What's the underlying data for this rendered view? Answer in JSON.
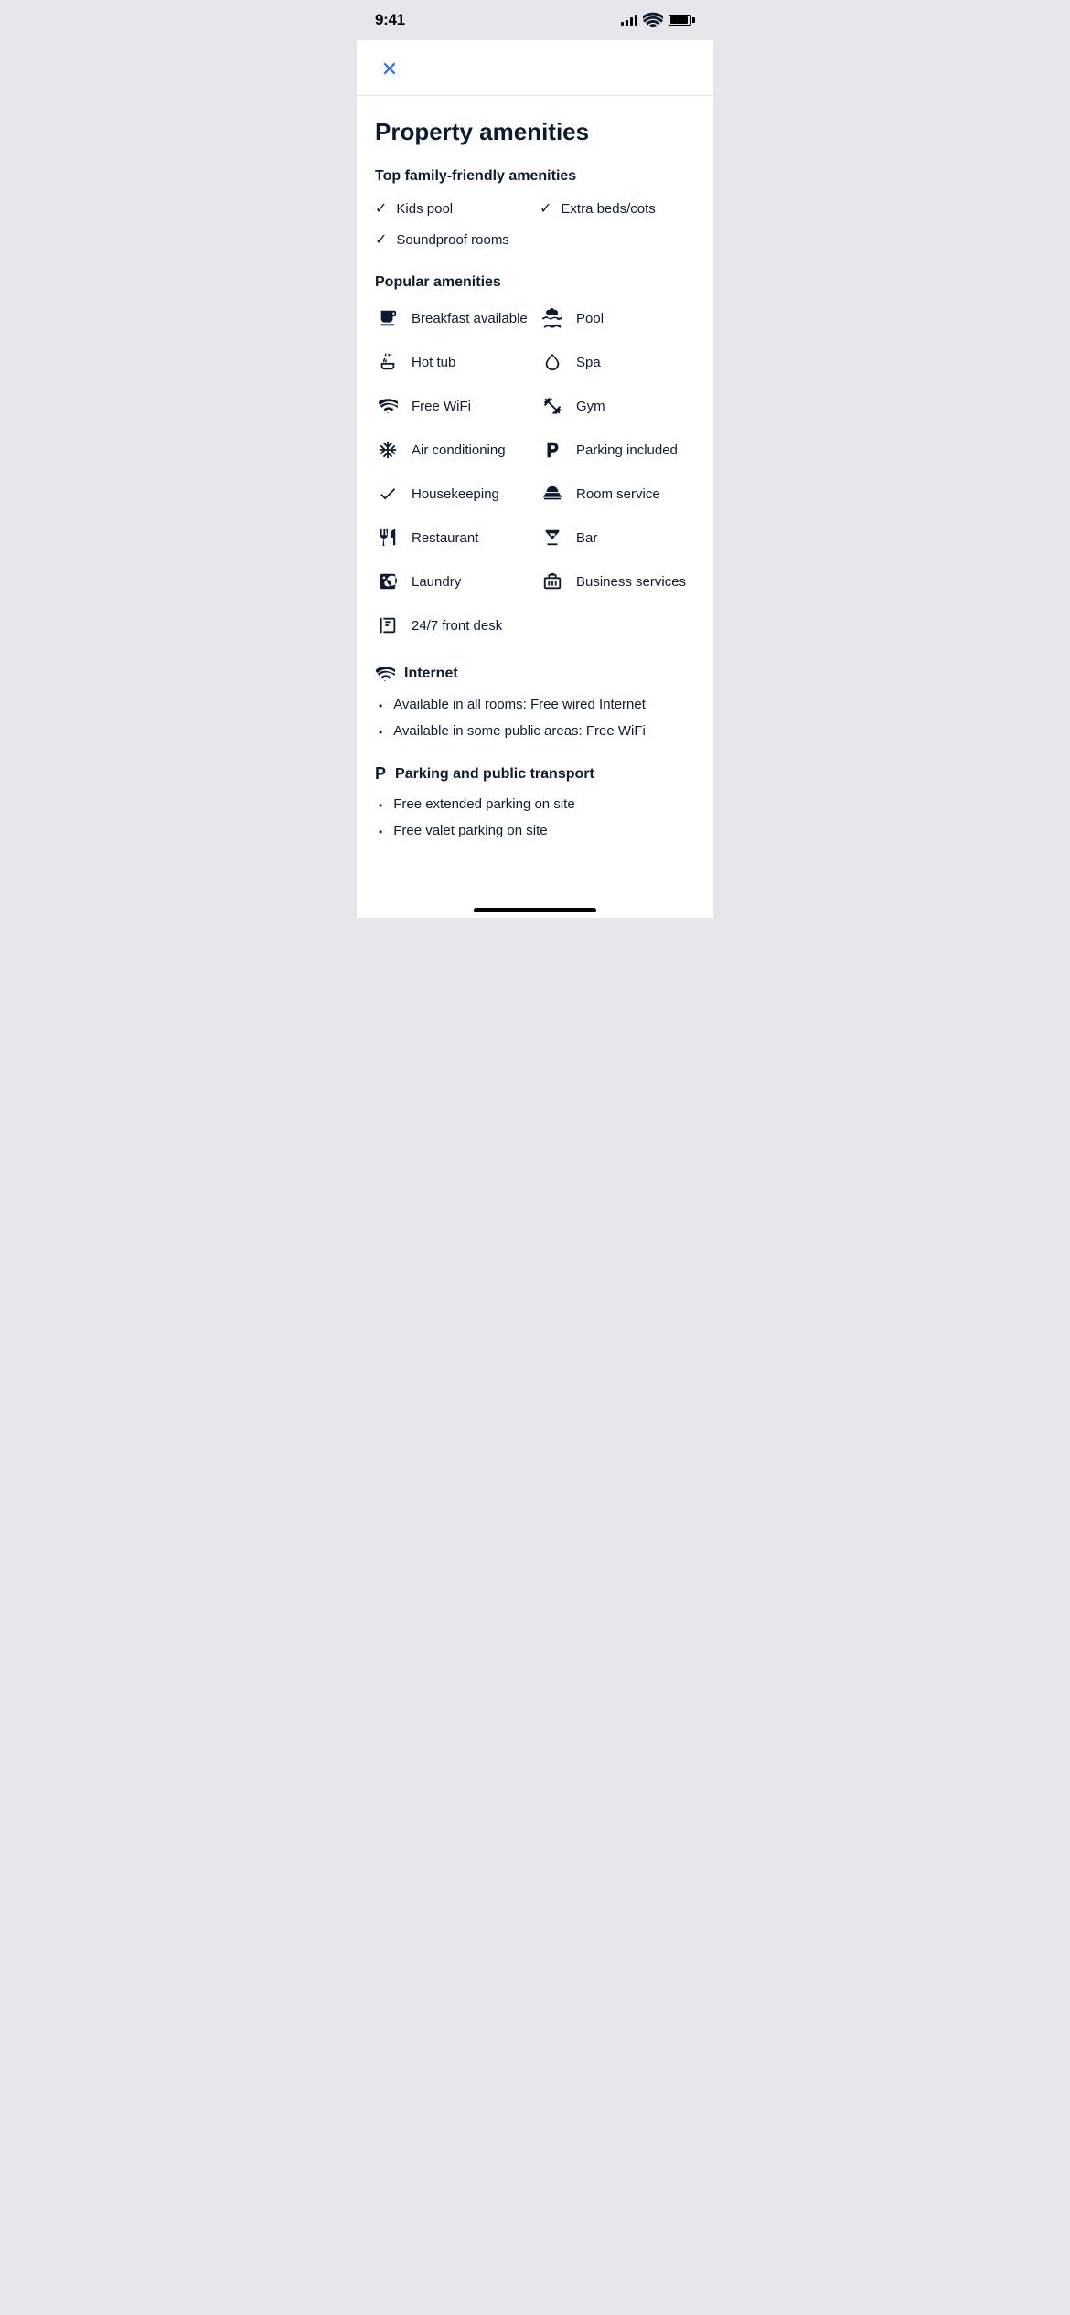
{
  "status_bar": {
    "time": "9:41"
  },
  "header": {
    "close_label": "✕"
  },
  "page": {
    "title": "Property amenities"
  },
  "family_section": {
    "title": "Top family-friendly amenities",
    "items": [
      {
        "label": "Kids pool",
        "full": false
      },
      {
        "label": "Extra beds/cots",
        "full": false
      },
      {
        "label": "Soundproof rooms",
        "full": true
      }
    ]
  },
  "popular_section": {
    "title": "Popular amenities",
    "items": [
      {
        "label": "Breakfast available",
        "icon": "coffee",
        "full": false,
        "col": 1
      },
      {
        "label": "Pool",
        "icon": "pool",
        "full": false,
        "col": 2
      },
      {
        "label": "Hot tub",
        "icon": "hottub",
        "full": false,
        "col": 1
      },
      {
        "label": "Spa",
        "icon": "spa",
        "full": false,
        "col": 2
      },
      {
        "label": "Free WiFi",
        "icon": "wifi",
        "full": false,
        "col": 1
      },
      {
        "label": "Gym",
        "icon": "gym",
        "full": false,
        "col": 2
      },
      {
        "label": "Air conditioning",
        "icon": "ac",
        "full": false,
        "col": 1
      },
      {
        "label": "Parking included",
        "icon": "parking",
        "full": false,
        "col": 2
      },
      {
        "label": "Housekeeping",
        "icon": "check",
        "full": false,
        "col": 1
      },
      {
        "label": "Room service",
        "icon": "roomservice",
        "full": false,
        "col": 2
      },
      {
        "label": "Restaurant",
        "icon": "restaurant",
        "full": false,
        "col": 1
      },
      {
        "label": "Bar",
        "icon": "bar",
        "full": false,
        "col": 2
      },
      {
        "label": "Laundry",
        "icon": "laundry",
        "full": false,
        "col": 1
      },
      {
        "label": "Business services",
        "icon": "business",
        "full": false,
        "col": 2
      },
      {
        "label": "24/7 front desk",
        "icon": "frontdesk",
        "full": true,
        "col": 1
      }
    ]
  },
  "internet_section": {
    "title": "Internet",
    "items": [
      "Available in all rooms: Free wired Internet",
      "Available in some public areas: Free WiFi"
    ]
  },
  "parking_section": {
    "title": "Parking and public transport",
    "items": [
      "Free extended parking on site",
      "Free valet parking on site"
    ]
  }
}
